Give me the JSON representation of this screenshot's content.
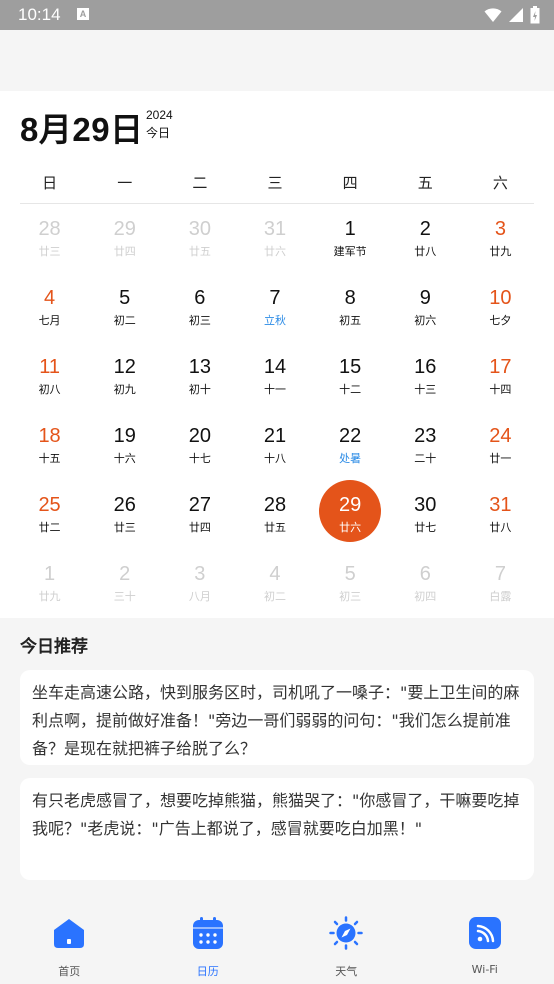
{
  "status_bar": {
    "time": "10:14",
    "notif_letter": "A"
  },
  "header": {
    "date": "8月29日",
    "year": "2024",
    "today_label": "今日"
  },
  "weekdays": [
    "日",
    "一",
    "二",
    "三",
    "四",
    "五",
    "六"
  ],
  "calendar": {
    "rows": [
      [
        {
          "d": "28",
          "l": "廿三",
          "muted": true
        },
        {
          "d": "29",
          "l": "廿四",
          "muted": true
        },
        {
          "d": "30",
          "l": "廿五",
          "muted": true
        },
        {
          "d": "31",
          "l": "廿六",
          "muted": true
        },
        {
          "d": "1",
          "l": "建军节"
        },
        {
          "d": "2",
          "l": "廿八"
        },
        {
          "d": "3",
          "l": "廿九",
          "weekend": true
        }
      ],
      [
        {
          "d": "4",
          "l": "七月",
          "weekend": true
        },
        {
          "d": "5",
          "l": "初二"
        },
        {
          "d": "6",
          "l": "初三"
        },
        {
          "d": "7",
          "l": "立秋",
          "festival": true
        },
        {
          "d": "8",
          "l": "初五"
        },
        {
          "d": "9",
          "l": "初六"
        },
        {
          "d": "10",
          "l": "七夕",
          "weekend": true
        }
      ],
      [
        {
          "d": "11",
          "l": "初八",
          "weekend": true
        },
        {
          "d": "12",
          "l": "初九"
        },
        {
          "d": "13",
          "l": "初十"
        },
        {
          "d": "14",
          "l": "十一"
        },
        {
          "d": "15",
          "l": "十二"
        },
        {
          "d": "16",
          "l": "十三"
        },
        {
          "d": "17",
          "l": "十四",
          "weekend": true
        }
      ],
      [
        {
          "d": "18",
          "l": "十五",
          "weekend": true
        },
        {
          "d": "19",
          "l": "十六"
        },
        {
          "d": "20",
          "l": "十七"
        },
        {
          "d": "21",
          "l": "十八"
        },
        {
          "d": "22",
          "l": "处暑",
          "festival": true
        },
        {
          "d": "23",
          "l": "二十"
        },
        {
          "d": "24",
          "l": "廿一",
          "weekend": true
        }
      ],
      [
        {
          "d": "25",
          "l": "廿二",
          "weekend": true
        },
        {
          "d": "26",
          "l": "廿三"
        },
        {
          "d": "27",
          "l": "廿四"
        },
        {
          "d": "28",
          "l": "廿五"
        },
        {
          "d": "29",
          "l": "廿六",
          "selected": true
        },
        {
          "d": "30",
          "l": "廿七"
        },
        {
          "d": "31",
          "l": "廿八",
          "weekend": true
        }
      ],
      [
        {
          "d": "1",
          "l": "廿九",
          "muted": true
        },
        {
          "d": "2",
          "l": "三十",
          "muted": true
        },
        {
          "d": "3",
          "l": "八月",
          "muted": true
        },
        {
          "d": "4",
          "l": "初二",
          "muted": true
        },
        {
          "d": "5",
          "l": "初三",
          "muted": true
        },
        {
          "d": "6",
          "l": "初四",
          "muted": true
        },
        {
          "d": "7",
          "l": "白露",
          "muted": true
        }
      ]
    ]
  },
  "recommend": {
    "title": "今日推荐",
    "items": [
      "坐车走高速公路，快到服务区时，司机吼了一嗓子：\"要上卫生间的麻利点啊，提前做好准备！\"旁边一哥们弱弱的问句：\"我们怎么提前准备？是现在就把裤子给脱了么？",
      "有只老虎感冒了，想要吃掉熊猫，熊猫哭了：\"你感冒了，干嘛要吃掉我呢？\"老虎说：\"广告上都说了，感冒就要吃白加黑！\""
    ]
  },
  "nav": [
    {
      "label": "首页",
      "icon": "home-icon"
    },
    {
      "label": "日历",
      "icon": "calendar-icon",
      "active": true
    },
    {
      "label": "天气",
      "icon": "weather-icon"
    },
    {
      "label": "Wi-Fi",
      "icon": "wifi-icon"
    }
  ],
  "colors": {
    "accent": "#e4541a",
    "festival": "#2d8ce6",
    "nav_active": "#2a73ff"
  }
}
